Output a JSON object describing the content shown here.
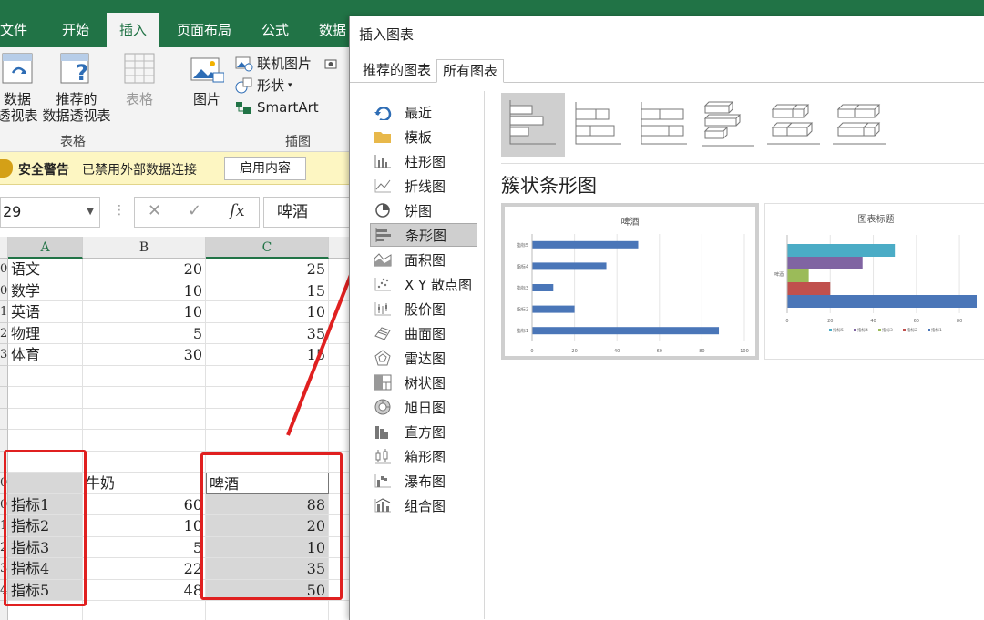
{
  "ribbon": {
    "tabs": [
      {
        "label": "文件",
        "active": false
      },
      {
        "label": "开始",
        "active": false
      },
      {
        "label": "插入",
        "active": true
      },
      {
        "label": "页面布局",
        "active": false
      },
      {
        "label": "公式",
        "active": false
      },
      {
        "label": "数据",
        "active": false
      }
    ],
    "table_group": {
      "pivot_line1": "数据",
      "pivot_line2": "透视表",
      "recommended_pivot_line1": "推荐的",
      "recommended_pivot_line2": "数据透视表",
      "table": "表格",
      "label": "表格"
    },
    "illustrations_group": {
      "picture": "图片",
      "online_picture": "联机图片",
      "shapes": "形状",
      "smartart": "SmartArt",
      "label": "插图"
    }
  },
  "security_bar": {
    "title": "安全警告",
    "message": "已禁用外部数据连接",
    "button": "启用内容"
  },
  "formula_bar": {
    "name_box": "29",
    "value": "啤酒"
  },
  "sheet": {
    "columns": [
      "A",
      "B",
      "C"
    ],
    "rows1": [
      {
        "rowlabel": "0",
        "a": "语文",
        "b": "20",
        "c": "25"
      },
      {
        "rowlabel": "0",
        "a": "数学",
        "b": "10",
        "c": "15"
      },
      {
        "rowlabel": "1",
        "a": "英语",
        "b": "10",
        "c": "10"
      },
      {
        "rowlabel": "2",
        "a": "物理",
        "b": "5",
        "c": "35"
      },
      {
        "rowlabel": "3",
        "a": "体育",
        "b": "30",
        "c": "15"
      }
    ],
    "rows2_header": {
      "rowlabel": "0",
      "a": "",
      "b": "牛奶",
      "c": "啤酒"
    },
    "rows2": [
      {
        "rowlabel": "0",
        "a": "指标1",
        "b": "60",
        "c": "88"
      },
      {
        "rowlabel": "1",
        "a": "指标2",
        "b": "10",
        "c": "20"
      },
      {
        "rowlabel": "2",
        "a": "指标3",
        "b": "5",
        "c": "10"
      },
      {
        "rowlabel": "3",
        "a": "指标4",
        "b": "22",
        "c": "35"
      },
      {
        "rowlabel": "4",
        "a": "指标5",
        "b": "48",
        "c": "50"
      }
    ],
    "highlight_color": "#e02020"
  },
  "dialog": {
    "title": "插入图表",
    "tabs": [
      {
        "label": "推荐的图表",
        "active": false
      },
      {
        "label": "所有图表",
        "active": true
      }
    ],
    "chart_types": [
      {
        "label": "最近",
        "icon": "recent-icon"
      },
      {
        "label": "模板",
        "icon": "folder-icon"
      },
      {
        "label": "柱形图",
        "icon": "column-chart-icon"
      },
      {
        "label": "折线图",
        "icon": "line-chart-icon"
      },
      {
        "label": "饼图",
        "icon": "pie-chart-icon"
      },
      {
        "label": "条形图",
        "icon": "bar-chart-icon",
        "selected": true
      },
      {
        "label": "面积图",
        "icon": "area-chart-icon"
      },
      {
        "label": "X Y 散点图",
        "icon": "scatter-chart-icon"
      },
      {
        "label": "股价图",
        "icon": "stock-chart-icon"
      },
      {
        "label": "曲面图",
        "icon": "surface-chart-icon"
      },
      {
        "label": "雷达图",
        "icon": "radar-chart-icon"
      },
      {
        "label": "树状图",
        "icon": "treemap-chart-icon"
      },
      {
        "label": "旭日图",
        "icon": "sunburst-chart-icon"
      },
      {
        "label": "直方图",
        "icon": "histogram-chart-icon"
      },
      {
        "label": "箱形图",
        "icon": "box-chart-icon"
      },
      {
        "label": "瀑布图",
        "icon": "waterfall-chart-icon"
      },
      {
        "label": "组合图",
        "icon": "combo-chart-icon"
      }
    ],
    "subtype_title": "簇状条形图",
    "previews": [
      {
        "title": "啤酒",
        "categories": [
          "指标1",
          "指标2",
          "指标3",
          "指标4",
          "指标5"
        ],
        "values": [
          88,
          20,
          10,
          35,
          50
        ],
        "xlim": [
          0,
          100
        ],
        "ticks": [
          "0",
          "20",
          "40",
          "60",
          "80",
          "100"
        ],
        "color": "#4a76b8"
      },
      {
        "title": "图表标题",
        "category": "啤酒",
        "series": [
          {
            "name": "指标1",
            "value": 88,
            "color": "#4a76b8"
          },
          {
            "name": "指标2",
            "value": 20,
            "color": "#c0504d"
          },
          {
            "name": "指标3",
            "value": 10,
            "color": "#9bbb59"
          },
          {
            "name": "指标4",
            "value": 35,
            "color": "#8064a2"
          },
          {
            "name": "指标5",
            "value": 50,
            "color": "#4bacc6"
          }
        ],
        "ticks": [
          "0",
          "20",
          "40",
          "60",
          "80"
        ],
        "legend": [
          "指标5",
          "指标4",
          "指标3",
          "指标2",
          "指标1"
        ]
      }
    ]
  }
}
